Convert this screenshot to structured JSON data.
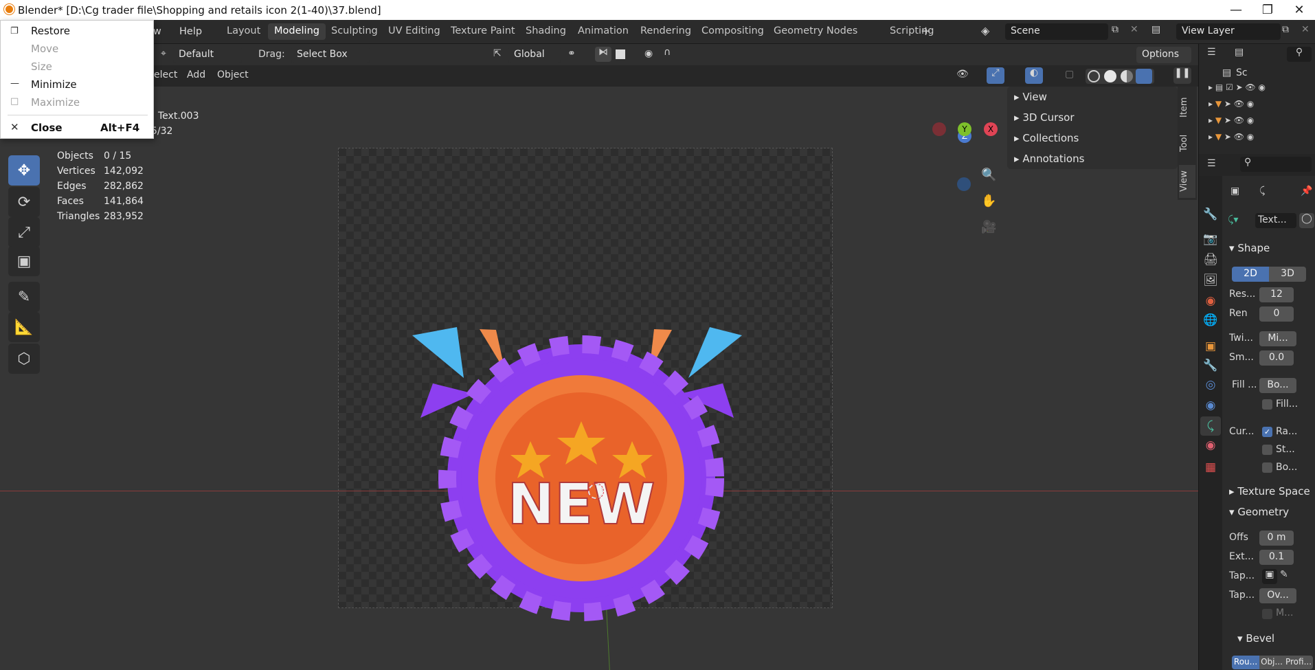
{
  "window": {
    "title": "Blender* [D:\\Cg trader file\\Shopping and retails icon 2(1-40)\\37.blend]"
  },
  "menus": [
    "ow",
    "Help"
  ],
  "workspaces": [
    "Layout",
    "Modeling",
    "Sculpting",
    "UV Editing",
    "Texture Paint",
    "Shading",
    "Animation",
    "Rendering",
    "Compositing",
    "Geometry Nodes",
    "Scripting"
  ],
  "add_workspace": "+",
  "scene": {
    "name": "Scene",
    "view_layer": "View Layer"
  },
  "tool_header": {
    "mode": "Default",
    "drag_label": "Drag:",
    "drag_value": "Select Box",
    "orientation": "Global",
    "options": "Options"
  },
  "viewport_header": {
    "select": "elect",
    "add": "Add",
    "object": "Object"
  },
  "context_menu": {
    "restore": "Restore",
    "move": "Move",
    "size": "Size",
    "minimize": "Minimize",
    "maximize": "Maximize",
    "close": "Close",
    "close_shortcut": "Alt+F4"
  },
  "overlay_info": {
    "object_name": "Text.003",
    "frame": "5/32"
  },
  "stats": [
    {
      "label": "Objects",
      "value": "0 / 15"
    },
    {
      "label": "Vertices",
      "value": "142,092"
    },
    {
      "label": "Edges",
      "value": "282,862"
    },
    {
      "label": "Faces",
      "value": "141,864"
    },
    {
      "label": "Triangles",
      "value": "283,952"
    }
  ],
  "n_panel": {
    "items": [
      "View",
      "3D Cursor",
      "Collections",
      "Annotations"
    ],
    "tabs": [
      "Item",
      "Tool",
      "View"
    ]
  },
  "gizmo": {
    "z": "Z",
    "y": "Y",
    "x": "X"
  },
  "badge": {
    "text": "NEW",
    "colors": {
      "ring": "#f07a3a",
      "scallop": "#8d3ff0",
      "accent_blue": "#4fb8f0",
      "star": "#f5a623"
    }
  },
  "outliner": {
    "root": "Sc"
  },
  "properties": {
    "object_name": "Text...",
    "shape": {
      "title": "Shape",
      "mode_2d": "2D",
      "mode_3d": "3D",
      "res_label": "Res...",
      "res_value": "12",
      "ren_label": "Ren",
      "ren_value": "0",
      "twi_label": "Twi...",
      "twi_value": "Mi...",
      "sm_label": "Sm...",
      "sm_value": "0.0",
      "fill_label": "Fill ...",
      "fill_value": "Bo...",
      "fill_chk": "Fill...",
      "cur_label": "Cur...",
      "cur_ra": "Ra...",
      "cur_st": "St...",
      "cur_bo": "Bo..."
    },
    "texture_space": "Texture Space",
    "geometry": {
      "title": "Geometry",
      "offs_label": "Offs",
      "offs_value": "0 m",
      "ext_label": "Ext...",
      "ext_value": "0.1",
      "tap1_label": "Tap...",
      "tap2_label": "Tap...",
      "tap2_value": "Ov...",
      "m_label": "M..."
    },
    "bevel": {
      "title": "Bevel",
      "modes": [
        "Rou...",
        "Obj...",
        "Profi..."
      ]
    }
  }
}
